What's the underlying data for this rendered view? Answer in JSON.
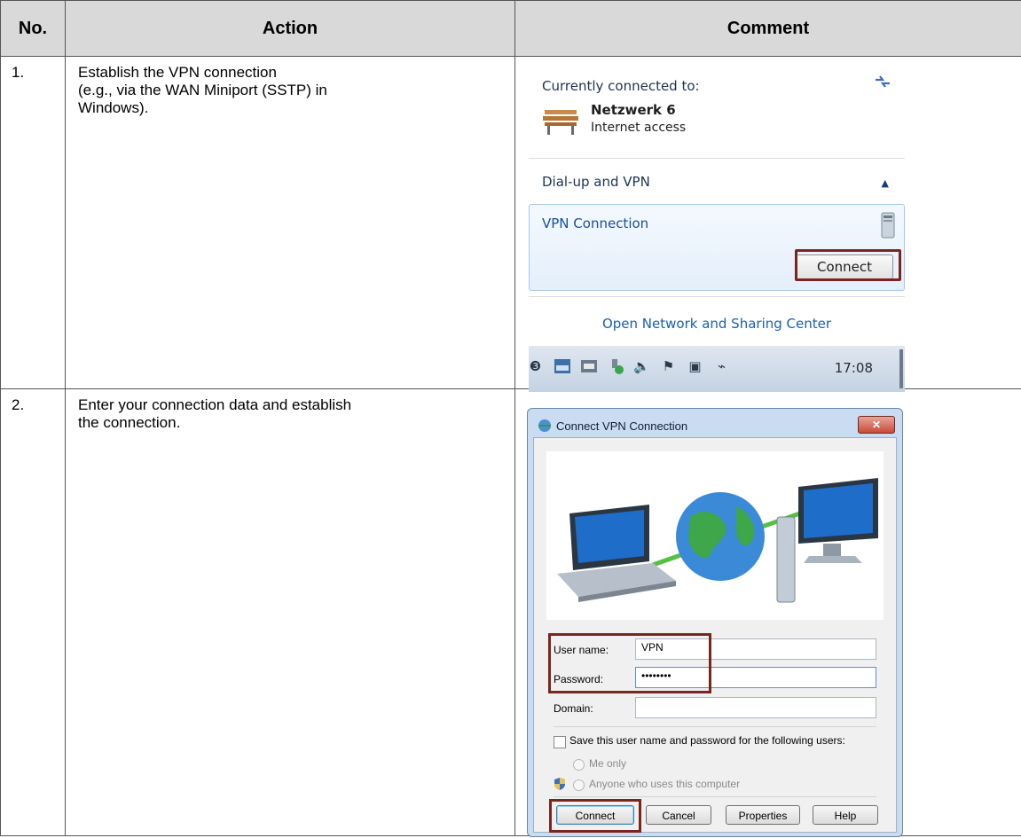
{
  "table": {
    "headers": [
      "No.",
      "Action",
      "Comment"
    ],
    "rows": [
      {
        "no": "1.",
        "action": [
          "Establish the VPN connection",
          "(e.g., via the WAN Miniport (SSTP) in",
          "Windows)."
        ]
      },
      {
        "no": "2.",
        "action": [
          "Enter your connection data and establish",
          "the connection."
        ]
      }
    ]
  },
  "flyout": {
    "header": "Currently connected to:",
    "network_name": "Netzwerk 6",
    "network_status": "Internet access",
    "section": "Dial-up and VPN",
    "vpn_name": "VPN Connection",
    "connect_button": "Connect",
    "open_center": "Open Network and Sharing Center",
    "clock": "17:08",
    "highlight_color": "#7a2620"
  },
  "dialog": {
    "title": "Connect VPN Connection",
    "close": "✕",
    "username_label": "User name:",
    "username_value": "VPN",
    "password_label": "Password:",
    "password_value": "••••••••",
    "domain_label": "Domain:",
    "domain_value": "",
    "save_checkbox_label": "Save this user name and password for the following users:",
    "save_checked": false,
    "radio_me": "Me only",
    "radio_anyone": "Anyone who uses this computer",
    "buttons": {
      "connect": "Connect",
      "cancel": "Cancel",
      "properties": "Properties",
      "help": "Help"
    }
  }
}
